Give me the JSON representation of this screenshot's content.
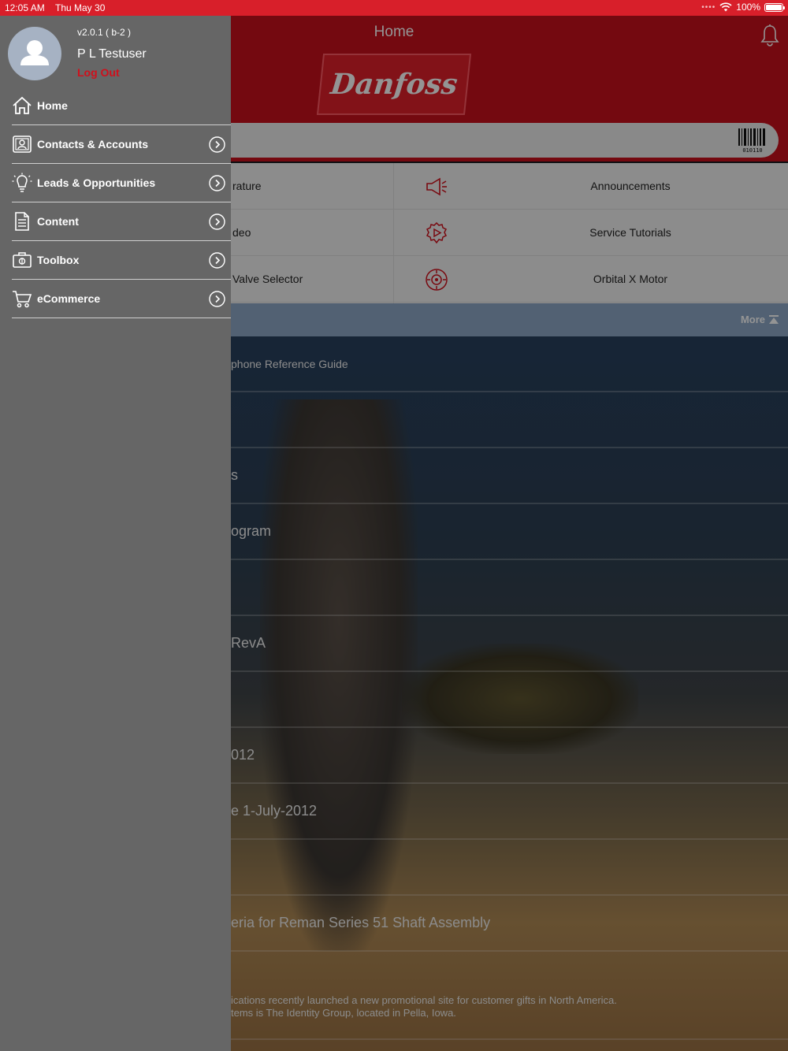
{
  "status_bar": {
    "time": "12:05 AM",
    "date": "Thu May 30",
    "signal_dots": "••••",
    "battery": "100%"
  },
  "header": {
    "title": "Home",
    "logo_text": "Danfoss",
    "barcode_digits": "010110"
  },
  "quick_links": {
    "left": [
      "rature",
      "deo",
      "Valve Selector"
    ],
    "right": [
      "Announcements",
      "Service Tutorials",
      "Orbital X Motor"
    ],
    "right_icons": [
      "megaphone-icon",
      "gear-play-icon",
      "motor-icon"
    ]
  },
  "news_header": {
    "more_label": "More"
  },
  "news": {
    "items": [
      "phone Reference Guide",
      "",
      "s",
      "ogram",
      "",
      "RevA",
      "",
      "012",
      "e 1-July-2012",
      "",
      "eria for Reman Series 51 Shaft Assembly",
      ""
    ],
    "last_item_lines": [
      "ications recently launched a new promotional site for customer gifts in North America.",
      "tems is The Identity Group, located in Pella, Iowa."
    ]
  },
  "drawer": {
    "version": "v2.0.1  ( b-2 )",
    "user_name": "P L Testuser",
    "logout_label": "Log Out",
    "menu": [
      {
        "label": "Home",
        "icon": "home-icon",
        "has_chevron": false
      },
      {
        "label": "Contacts & Accounts",
        "icon": "contacts-icon",
        "has_chevron": true
      },
      {
        "label": "Leads & Opportunities",
        "icon": "lightbulb-icon",
        "has_chevron": true
      },
      {
        "label": "Content",
        "icon": "document-icon",
        "has_chevron": true
      },
      {
        "label": "Toolbox",
        "icon": "toolbox-icon",
        "has_chevron": true
      },
      {
        "label": "eCommerce",
        "icon": "cart-icon",
        "has_chevron": true
      }
    ]
  },
  "colors": {
    "brand_red": "#c8101c",
    "status_bar_red": "#d81f2a",
    "drawer_gray": "#666666",
    "logout_red": "#d0101c",
    "news_header_blue": "#8ea8c6"
  }
}
